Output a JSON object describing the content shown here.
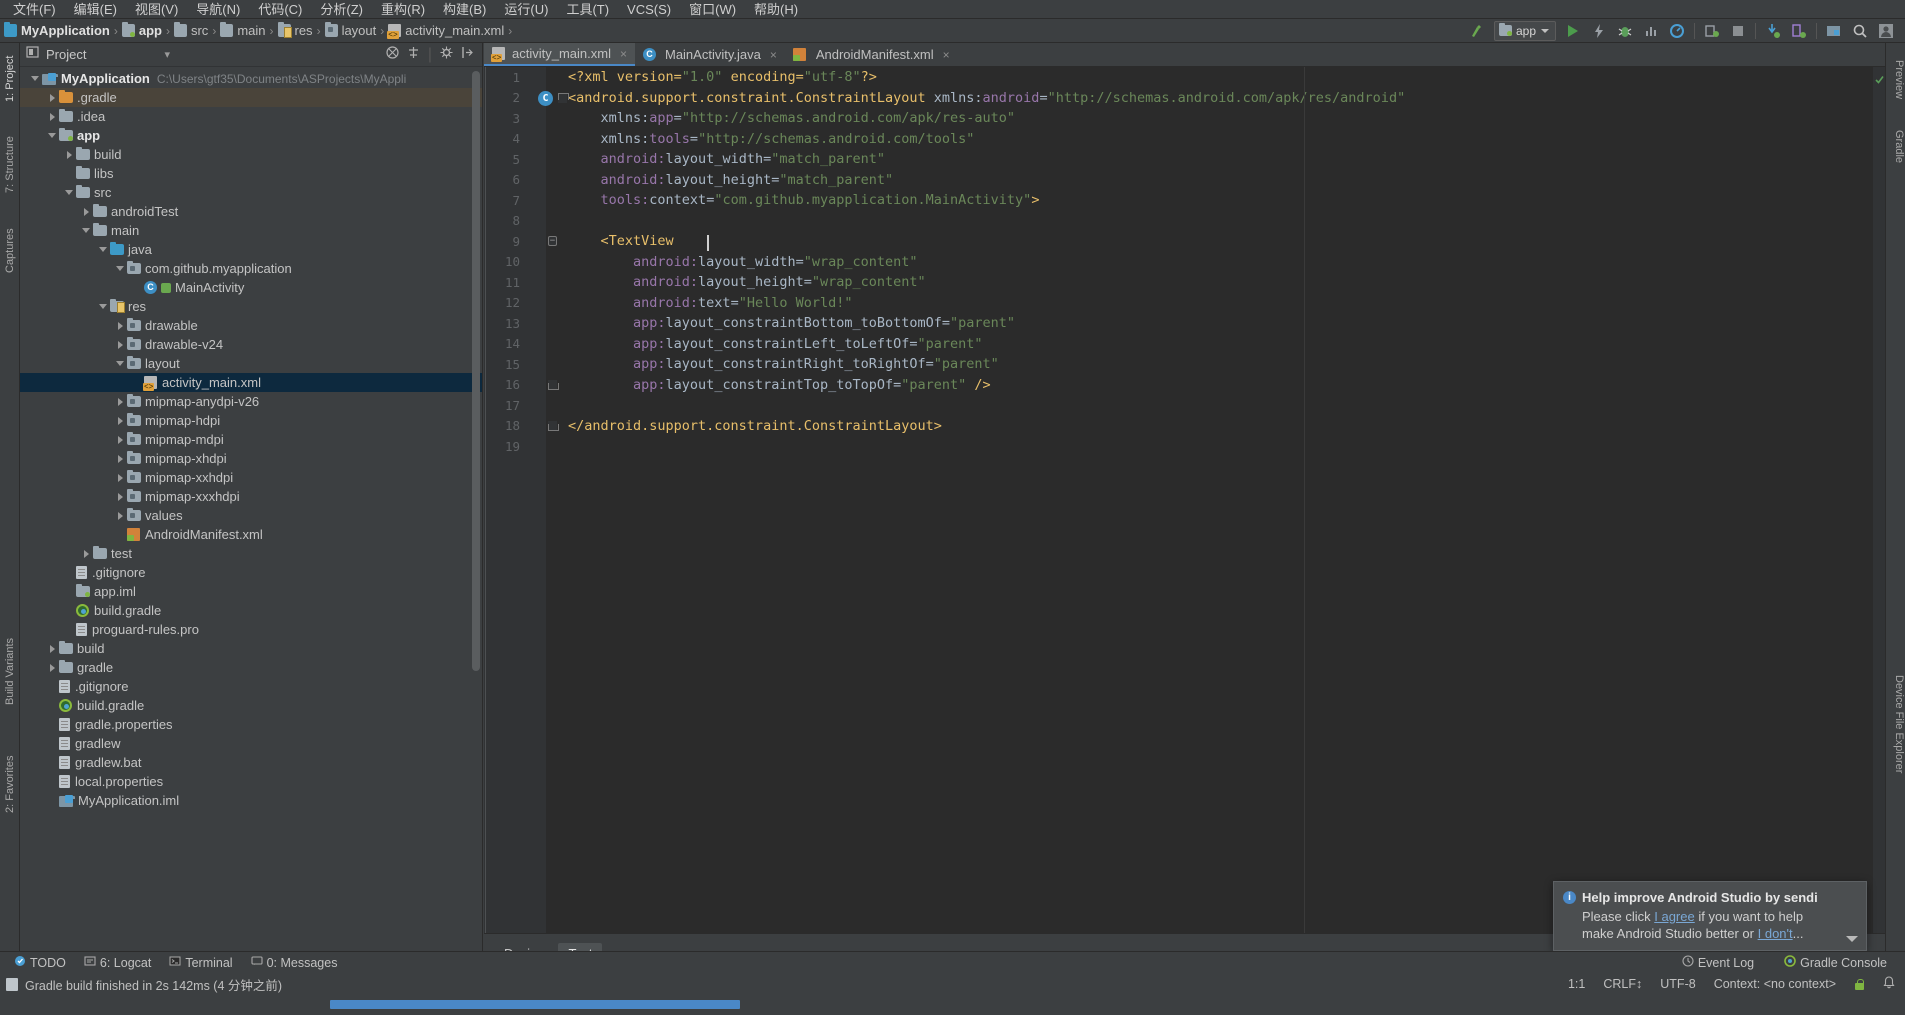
{
  "menubar": {
    "items": [
      {
        "label": "文件(F)"
      },
      {
        "label": "编辑(E)"
      },
      {
        "label": "视图(V)"
      },
      {
        "label": "导航(N)"
      },
      {
        "label": "代码(C)"
      },
      {
        "label": "分析(Z)"
      },
      {
        "label": "重构(R)"
      },
      {
        "label": "构建(B)"
      },
      {
        "label": "运行(U)"
      },
      {
        "label": "工具(T)"
      },
      {
        "label": "VCS(S)"
      },
      {
        "label": "窗口(W)"
      },
      {
        "label": "帮助(H)"
      }
    ]
  },
  "breadcrumb": {
    "items": [
      {
        "label": "MyApplication",
        "icon": "module-icon"
      },
      {
        "label": "app",
        "icon": "module-folder-icon"
      },
      {
        "label": "src",
        "icon": "folder-icon"
      },
      {
        "label": "main",
        "icon": "folder-icon"
      },
      {
        "label": "res",
        "icon": "res-folder-icon"
      },
      {
        "label": "layout",
        "icon": "layout-folder-icon"
      },
      {
        "label": "activity_main.xml",
        "icon": "xml-file-icon"
      }
    ],
    "separator": "›"
  },
  "toolbar": {
    "run_config": "app",
    "buttons": [
      {
        "name": "update-project-icon",
        "label": "Update Project"
      },
      {
        "name": "run-icon",
        "label": "Run"
      },
      {
        "name": "apply-changes-icon",
        "label": "Apply Changes"
      },
      {
        "name": "debug-icon",
        "label": "Debug"
      },
      {
        "name": "profile-icon",
        "label": "Profile"
      },
      {
        "name": "avd-monitor-icon",
        "label": "Android Profiler"
      },
      {
        "name": "attach-debugger-icon",
        "label": "Attach Debugger"
      },
      {
        "name": "stop-icon",
        "label": "Stop"
      },
      {
        "name": "sync-gradle-icon",
        "label": "Sync Project with Gradle Files"
      },
      {
        "name": "avd-manager-icon",
        "label": "AVD Manager"
      },
      {
        "name": "sdk-manager-icon",
        "label": "SDK Manager"
      },
      {
        "name": "search-icon",
        "label": "Search Everywhere"
      },
      {
        "name": "user-account-icon",
        "label": "Account"
      }
    ]
  },
  "left_rail": {
    "items": [
      {
        "label": "1: Project",
        "active": true
      },
      {
        "label": "7: Structure",
        "active": false
      },
      {
        "label": "Captures",
        "active": false
      },
      {
        "label": "Build Variants",
        "active": false
      },
      {
        "label": "2: Favorites",
        "active": false
      }
    ]
  },
  "right_rail": {
    "items": [
      {
        "label": "Preview"
      },
      {
        "label": "Gradle"
      },
      {
        "label": "Device File Explorer"
      }
    ]
  },
  "project_panel": {
    "title": "Project",
    "dropdown_caret": "▾",
    "actions": [
      "collapse-all-icon",
      "locate-icon",
      "settings-icon",
      "hide-icon"
    ],
    "tree": [
      {
        "indent": 0,
        "arrow": "down",
        "icon": "module-icon",
        "label": "MyApplication",
        "bold": true,
        "path": "C:\\Users\\gtf35\\Documents\\ASProjects\\MyAppli"
      },
      {
        "indent": 1,
        "arrow": "right",
        "icon": "folder-orange-icon",
        "label": ".gradle",
        "hover": true
      },
      {
        "indent": 1,
        "arrow": "right",
        "icon": "folder-icon",
        "label": ".idea"
      },
      {
        "indent": 1,
        "arrow": "down",
        "icon": "module-folder-icon",
        "label": "app",
        "bold": true
      },
      {
        "indent": 2,
        "arrow": "right",
        "icon": "folder-icon",
        "label": "build"
      },
      {
        "indent": 2,
        "arrow": "none",
        "icon": "folder-icon",
        "label": "libs"
      },
      {
        "indent": 2,
        "arrow": "down",
        "icon": "folder-icon",
        "label": "src"
      },
      {
        "indent": 3,
        "arrow": "right",
        "icon": "folder-icon",
        "label": "androidTest"
      },
      {
        "indent": 3,
        "arrow": "down",
        "icon": "folder-icon",
        "label": "main"
      },
      {
        "indent": 4,
        "arrow": "down",
        "icon": "folder-blue-icon",
        "label": "java"
      },
      {
        "indent": 5,
        "arrow": "down",
        "icon": "package-icon",
        "label": "com.github.myapplication"
      },
      {
        "indent": 6,
        "arrow": "none",
        "icon": "java-class-icon",
        "label": "MainActivity"
      },
      {
        "indent": 4,
        "arrow": "down",
        "icon": "res-folder-icon",
        "label": "res"
      },
      {
        "indent": 5,
        "arrow": "right",
        "icon": "layout-folder-icon",
        "label": "drawable"
      },
      {
        "indent": 5,
        "arrow": "right",
        "icon": "layout-folder-icon",
        "label": "drawable-v24"
      },
      {
        "indent": 5,
        "arrow": "down",
        "icon": "layout-folder-icon",
        "label": "layout"
      },
      {
        "indent": 6,
        "arrow": "none",
        "icon": "xml-file-icon",
        "label": "activity_main.xml",
        "selected": true
      },
      {
        "indent": 5,
        "arrow": "right",
        "icon": "layout-folder-icon",
        "label": "mipmap-anydpi-v26"
      },
      {
        "indent": 5,
        "arrow": "right",
        "icon": "layout-folder-icon",
        "label": "mipmap-hdpi"
      },
      {
        "indent": 5,
        "arrow": "right",
        "icon": "layout-folder-icon",
        "label": "mipmap-mdpi"
      },
      {
        "indent": 5,
        "arrow": "right",
        "icon": "layout-folder-icon",
        "label": "mipmap-xhdpi"
      },
      {
        "indent": 5,
        "arrow": "right",
        "icon": "layout-folder-icon",
        "label": "mipmap-xxhdpi"
      },
      {
        "indent": 5,
        "arrow": "right",
        "icon": "layout-folder-icon",
        "label": "mipmap-xxxhdpi"
      },
      {
        "indent": 5,
        "arrow": "right",
        "icon": "layout-folder-icon",
        "label": "values"
      },
      {
        "indent": 5,
        "arrow": "none",
        "icon": "manifest-icon",
        "label": "AndroidManifest.xml"
      },
      {
        "indent": 3,
        "arrow": "right",
        "icon": "folder-icon",
        "label": "test"
      },
      {
        "indent": 2,
        "arrow": "none",
        "icon": "text-file-icon",
        "label": ".gitignore"
      },
      {
        "indent": 2,
        "arrow": "none",
        "icon": "module-folder-icon",
        "label": "app.iml"
      },
      {
        "indent": 2,
        "arrow": "none",
        "icon": "gradle-file-icon",
        "label": "build.gradle"
      },
      {
        "indent": 2,
        "arrow": "none",
        "icon": "text-file-icon",
        "label": "proguard-rules.pro"
      },
      {
        "indent": 1,
        "arrow": "right",
        "icon": "folder-icon",
        "label": "build"
      },
      {
        "indent": 1,
        "arrow": "right",
        "icon": "folder-icon",
        "label": "gradle"
      },
      {
        "indent": 1,
        "arrow": "none",
        "icon": "text-file-icon",
        "label": ".gitignore"
      },
      {
        "indent": 1,
        "arrow": "none",
        "icon": "gradle-file-icon",
        "label": "build.gradle"
      },
      {
        "indent": 1,
        "arrow": "none",
        "icon": "properties-file-icon",
        "label": "gradle.properties"
      },
      {
        "indent": 1,
        "arrow": "none",
        "icon": "text-file-icon",
        "label": "gradlew"
      },
      {
        "indent": 1,
        "arrow": "none",
        "icon": "text-file-icon",
        "label": "gradlew.bat"
      },
      {
        "indent": 1,
        "arrow": "none",
        "icon": "properties-file-icon",
        "label": "local.properties"
      },
      {
        "indent": 1,
        "arrow": "none",
        "icon": "module-icon",
        "label": "MyApplication.iml"
      }
    ]
  },
  "editor": {
    "tabs": [
      {
        "label": "activity_main.xml",
        "icon": "xml-file-icon",
        "active": true,
        "close": "×"
      },
      {
        "label": "MainActivity.java",
        "icon": "java-class-icon",
        "active": false,
        "close": "×"
      },
      {
        "label": "AndroidManifest.xml",
        "icon": "manifest-icon",
        "active": false,
        "close": "×"
      }
    ],
    "lines": [
      {
        "n": "1",
        "gutter": "",
        "segments": [
          {
            "t": "<?xml version=",
            "c": "s-tag"
          },
          {
            "t": "\"1.0\"",
            "c": "s-val"
          },
          {
            "t": " encoding=",
            "c": "s-tag"
          },
          {
            "t": "\"utf-8\"",
            "c": "s-val"
          },
          {
            "t": "?>",
            "c": "s-tag"
          }
        ]
      },
      {
        "n": "2",
        "gutter": "class-badge-fold",
        "segments": [
          {
            "t": "<android.support.constraint.ConstraintLayout ",
            "c": "s-tag"
          },
          {
            "t": "xmlns:",
            "c": "s-plain"
          },
          {
            "t": "android",
            "c": "s-attr"
          },
          {
            "t": "=",
            "c": "s-plain"
          },
          {
            "t": "\"http://schemas.android.com/apk/res/android\"",
            "c": "s-val"
          }
        ]
      },
      {
        "n": "3",
        "gutter": "",
        "segments": [
          {
            "t": "    xmlns:",
            "c": "s-plain"
          },
          {
            "t": "app",
            "c": "s-attr"
          },
          {
            "t": "=",
            "c": "s-plain"
          },
          {
            "t": "\"http://schemas.android.com/apk/res-auto\"",
            "c": "s-val"
          }
        ]
      },
      {
        "n": "4",
        "gutter": "",
        "segments": [
          {
            "t": "    xmlns:",
            "c": "s-plain"
          },
          {
            "t": "tools",
            "c": "s-attr"
          },
          {
            "t": "=",
            "c": "s-plain"
          },
          {
            "t": "\"http://schemas.android.com/tools\"",
            "c": "s-val"
          }
        ]
      },
      {
        "n": "5",
        "gutter": "",
        "segments": [
          {
            "t": "    android:",
            "c": "s-attr"
          },
          {
            "t": "layout_width",
            "c": "s-plain"
          },
          {
            "t": "=",
            "c": "s-plain"
          },
          {
            "t": "\"match_parent\"",
            "c": "s-val"
          }
        ]
      },
      {
        "n": "6",
        "gutter": "",
        "segments": [
          {
            "t": "    android:",
            "c": "s-attr"
          },
          {
            "t": "layout_height",
            "c": "s-plain"
          },
          {
            "t": "=",
            "c": "s-plain"
          },
          {
            "t": "\"match_parent\"",
            "c": "s-val"
          }
        ]
      },
      {
        "n": "7",
        "gutter": "",
        "segments": [
          {
            "t": "    tools:",
            "c": "s-attr"
          },
          {
            "t": "context",
            "c": "s-plain"
          },
          {
            "t": "=",
            "c": "s-plain"
          },
          {
            "t": "\"com.github.myapplication.MainActivity\"",
            "c": "s-val"
          },
          {
            "t": ">",
            "c": "s-tag"
          }
        ]
      },
      {
        "n": "8",
        "gutter": "",
        "segments": []
      },
      {
        "n": "9",
        "gutter": "fold",
        "segments": [
          {
            "t": "    <TextView",
            "c": "s-tag"
          }
        ]
      },
      {
        "n": "10",
        "gutter": "",
        "segments": [
          {
            "t": "        android:",
            "c": "s-attr"
          },
          {
            "t": "layout_width",
            "c": "s-plain"
          },
          {
            "t": "=",
            "c": "s-plain"
          },
          {
            "t": "\"wrap_content\"",
            "c": "s-val"
          }
        ]
      },
      {
        "n": "11",
        "gutter": "",
        "segments": [
          {
            "t": "        android:",
            "c": "s-attr"
          },
          {
            "t": "layout_height",
            "c": "s-plain"
          },
          {
            "t": "=",
            "c": "s-plain"
          },
          {
            "t": "\"wrap_content\"",
            "c": "s-val"
          }
        ]
      },
      {
        "n": "12",
        "gutter": "",
        "segments": [
          {
            "t": "        android:",
            "c": "s-attr"
          },
          {
            "t": "text",
            "c": "s-plain"
          },
          {
            "t": "=",
            "c": "s-plain"
          },
          {
            "t": "\"Hello World!\"",
            "c": "s-val"
          }
        ]
      },
      {
        "n": "13",
        "gutter": "",
        "segments": [
          {
            "t": "        app:",
            "c": "s-attr"
          },
          {
            "t": "layout_constraintBottom_toBottomOf",
            "c": "s-plain"
          },
          {
            "t": "=",
            "c": "s-plain"
          },
          {
            "t": "\"parent\"",
            "c": "s-val"
          }
        ]
      },
      {
        "n": "14",
        "gutter": "",
        "segments": [
          {
            "t": "        app:",
            "c": "s-attr"
          },
          {
            "t": "layout_constraintLeft_toLeftOf",
            "c": "s-plain"
          },
          {
            "t": "=",
            "c": "s-plain"
          },
          {
            "t": "\"parent\"",
            "c": "s-val"
          }
        ]
      },
      {
        "n": "15",
        "gutter": "",
        "segments": [
          {
            "t": "        app:",
            "c": "s-attr"
          },
          {
            "t": "layout_constraintRight_toRightOf",
            "c": "s-plain"
          },
          {
            "t": "=",
            "c": "s-plain"
          },
          {
            "t": "\"parent\"",
            "c": "s-val"
          }
        ]
      },
      {
        "n": "16",
        "gutter": "fold-end",
        "segments": [
          {
            "t": "        app:",
            "c": "s-attr"
          },
          {
            "t": "layout_constraintTop_toTopOf",
            "c": "s-plain"
          },
          {
            "t": "=",
            "c": "s-plain"
          },
          {
            "t": "\"parent\"",
            "c": "s-val"
          },
          {
            "t": " />",
            "c": "s-tag"
          }
        ]
      },
      {
        "n": "17",
        "gutter": "",
        "segments": []
      },
      {
        "n": "18",
        "gutter": "fold-end",
        "segments": [
          {
            "t": "</android.support.constraint.ConstraintLayout>",
            "c": "s-tag"
          }
        ]
      },
      {
        "n": "19",
        "gutter": "",
        "segments": []
      }
    ],
    "mode_tabs": [
      {
        "label": "Design",
        "active": false
      },
      {
        "label": "Text",
        "active": true
      }
    ]
  },
  "notification": {
    "title": "Help improve Android Studio by sendi",
    "line1_pre": "Please click ",
    "line1_link": "I agree",
    "line1_post": " if you want to help",
    "line2_pre": "make Android Studio better or ",
    "line2_link": "I don't",
    "line2_post": "...",
    "expand_icon": "chevron-down-icon"
  },
  "bottom_bar": {
    "left_items": [
      {
        "label": "TODO",
        "icon": "todo-icon"
      },
      {
        "label": "6: Logcat",
        "icon": "logcat-icon"
      },
      {
        "label": "Terminal",
        "icon": "terminal-icon"
      },
      {
        "label": "0: Messages",
        "icon": "messages-icon"
      }
    ],
    "right_items": [
      {
        "label": "Event Log",
        "icon": "event-log-icon"
      },
      {
        "label": "Gradle Console",
        "icon": "gradle-console-icon"
      }
    ]
  },
  "status_bar": {
    "message": "Gradle build finished in 2s 142ms (4 分钟之前)",
    "caret_position": "1:1",
    "line_separator": "CRLF↕",
    "encoding": "UTF-8",
    "context": "Context: <no context>",
    "lock_icon": "lock-icon",
    "notification_icon": "bell-icon"
  }
}
